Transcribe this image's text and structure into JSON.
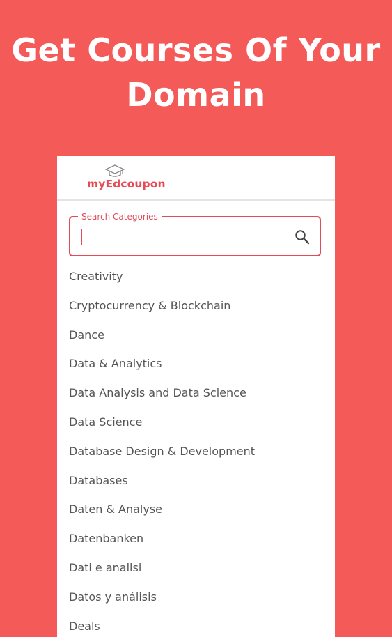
{
  "headline": {
    "line1": "Get Courses Of Your",
    "line2": "Domain"
  },
  "app": {
    "logo_text": "myEdcoupon",
    "logo_icon": "graduation-cap-icon"
  },
  "search": {
    "label": "Search Categories",
    "value": "",
    "icon": "search-icon"
  },
  "categories": [
    {
      "label": "Creativity"
    },
    {
      "label": "Cryptocurrency & Blockchain"
    },
    {
      "label": "Dance"
    },
    {
      "label": "Data & Analytics"
    },
    {
      "label": "Data Analysis and Data Science"
    },
    {
      "label": "Data Science"
    },
    {
      "label": "Database Design & Development"
    },
    {
      "label": "Databases"
    },
    {
      "label": "Daten & Analyse"
    },
    {
      "label": "Datenbanken"
    },
    {
      "label": "Dati e analisi"
    },
    {
      "label": "Datos y análisis"
    },
    {
      "label": "Deals"
    }
  ],
  "colors": {
    "background": "#f35a58",
    "accent": "#e14b5a",
    "logo": "#e74a54",
    "list_text": "#555555"
  }
}
